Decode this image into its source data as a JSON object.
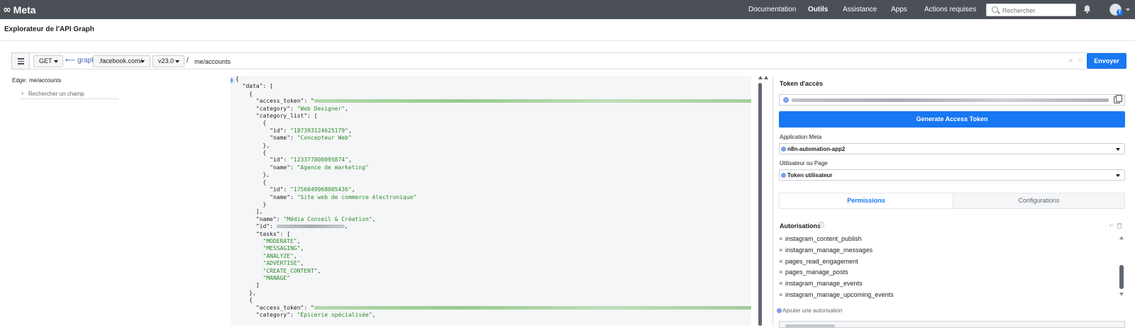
{
  "nav": {
    "logo_text": "Meta",
    "links": [
      "Documentation",
      "Outils",
      "Assistance",
      "Apps",
      "Actions requises"
    ],
    "active_link": "Outils",
    "search_placeholder": "Rechercher"
  },
  "page": {
    "title": "Explorateur de l'API Graph"
  },
  "request": {
    "method": "GET",
    "domain_prefix": "⟵ graph.",
    "domain": ".facebook.com/",
    "version": "v23.0",
    "separator": "/",
    "path": "me/accounts",
    "send_label": "Envoyer"
  },
  "left_panel": {
    "edge_label": "Edge:",
    "edge_value": "me/accounts",
    "search_field_label": "Rechercher un champ"
  },
  "response": {
    "lines": [
      {
        "t": "{"
      },
      {
        "t": "  \"data\": ["
      },
      {
        "t": "    {"
      },
      {
        "t": "      \"access_token\": \"",
        "blur": "g",
        "bw": 620
      },
      {
        "t": "      \"category\": ",
        "s": "\"Web Designer\"",
        "after": ","
      },
      {
        "t": "      \"category_list\": ["
      },
      {
        "t": "        {"
      },
      {
        "t": "          \"id\": ",
        "s": "\"187393124625179\"",
        "after": ","
      },
      {
        "t": "          \"name\": ",
        "s": "\"Concepteur Web\""
      },
      {
        "t": "        },"
      },
      {
        "t": "        {"
      },
      {
        "t": "          \"id\": ",
        "s": "\"123377808095874\"",
        "after": ","
      },
      {
        "t": "          \"name\": ",
        "s": "\"Agence de marketing\""
      },
      {
        "t": "        },"
      },
      {
        "t": "        {"
      },
      {
        "t": "          \"id\": ",
        "s": "\"1756049968005436\"",
        "after": ","
      },
      {
        "t": "          \"name\": ",
        "s": "\"Site web de commerce électronique\""
      },
      {
        "t": "        }"
      },
      {
        "t": "      ],"
      },
      {
        "t": "      \"name\": ",
        "s": "\"Média Conseil & Création\"",
        "after": ","
      },
      {
        "t": "      \"id\": ",
        "blur": "gr",
        "bw": 96,
        "after": ","
      },
      {
        "t": "      \"tasks\": ["
      },
      {
        "t": "        ",
        "s": "\"MODERATE\"",
        "after": ","
      },
      {
        "t": "        ",
        "s": "\"MESSAGING\"",
        "after": ","
      },
      {
        "t": "        ",
        "s": "\"ANALYZE\"",
        "after": ","
      },
      {
        "t": "        ",
        "s": "\"ADVERTISE\"",
        "after": ","
      },
      {
        "t": "        ",
        "s": "\"CREATE_CONTENT\"",
        "after": ","
      },
      {
        "t": "        ",
        "s": "\"MANAGE\""
      },
      {
        "t": "      ]"
      },
      {
        "t": "    },"
      },
      {
        "t": "    {"
      },
      {
        "t": "      \"access_token\": \"",
        "blur": "g",
        "bw": 620
      },
      {
        "t": "      \"category\": ",
        "s": "\"Épicerie spécialisée\"",
        "after": ","
      }
    ]
  },
  "right_panel": {
    "token_title": "Token d'accès",
    "generate_label": "Generate Access Token",
    "app_label": "Application Meta",
    "app_value": "n8n-automation-app2",
    "user_label": "Utilisateur ou Page",
    "user_value": "Token utilisateur",
    "tabs": [
      "Permissions",
      "Configurations"
    ],
    "permissions_title": "Autorisations",
    "permissions": [
      "instagram_content_publish",
      "instagram_manage_messages",
      "pages_read_engagement",
      "pages_manage_posts",
      "instagram_manage_events",
      "instagram_manage_upcoming_events"
    ],
    "add_permission": "Ajouter une autorisation"
  },
  "colors": {
    "topbar": "#4b4f56",
    "primary": "#1877f2",
    "string": "#2d8b2d"
  },
  "icons": [
    "search-icon",
    "bell-icon",
    "avatar",
    "menu-icon",
    "close-icon",
    "star-icon",
    "copy-icon",
    "info-icon",
    "undo-icon",
    "trash-icon",
    "plus-icon"
  ]
}
